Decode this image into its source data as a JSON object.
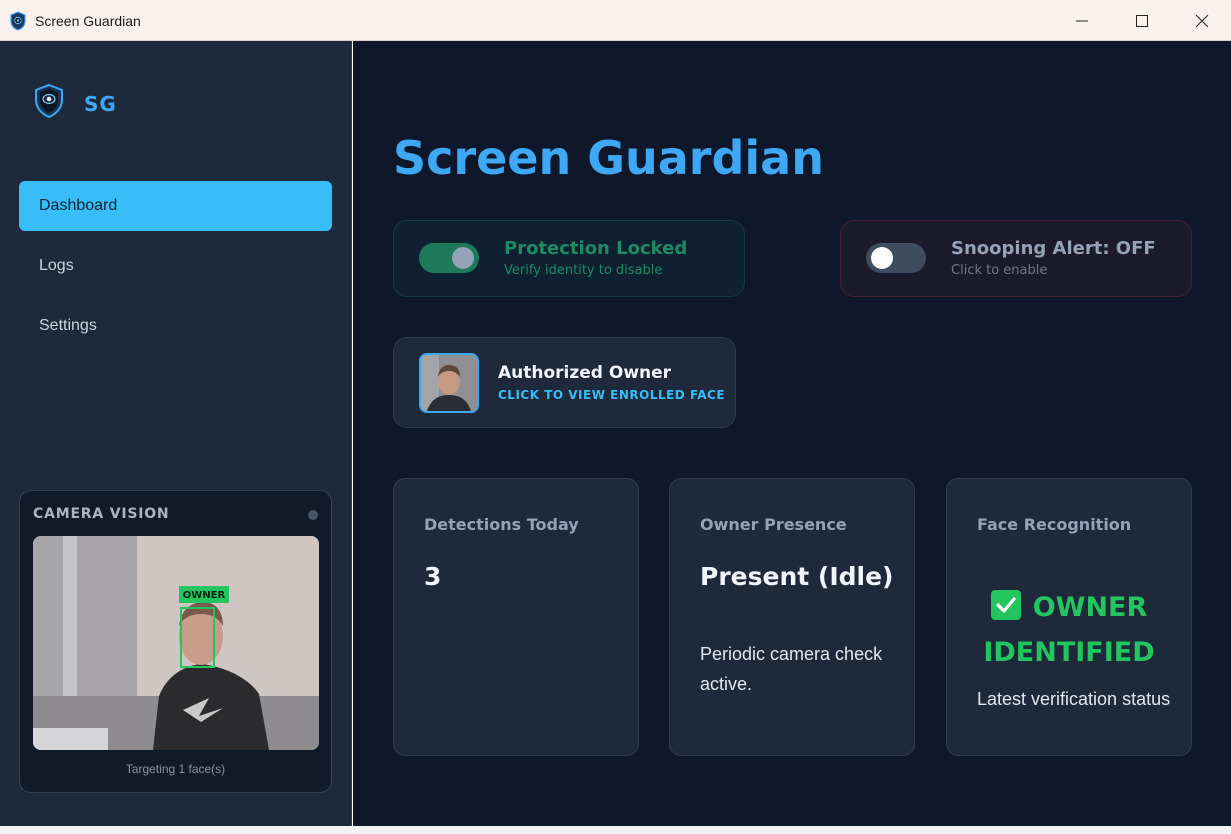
{
  "window": {
    "title": "Screen Guardian",
    "icons": [
      "shield-app-icon",
      "minimize-icon",
      "maximize-icon",
      "close-icon"
    ]
  },
  "sidebar": {
    "logo_text": "SG",
    "nav": [
      {
        "label": "Dashboard",
        "active": true
      },
      {
        "label": "Logs",
        "active": false
      },
      {
        "label": "Settings",
        "active": false
      }
    ],
    "camera": {
      "title": "CAMERA VISION",
      "overlay_label": "OWNER",
      "caption": "Targeting 1 face(s)"
    }
  },
  "main": {
    "title": "Screen Guardian",
    "protection": {
      "title": "Protection Locked",
      "subtitle": "Verify identity to disable",
      "state": "on"
    },
    "snooping": {
      "title": "Snooping Alert: OFF",
      "subtitle": "Click to enable",
      "state": "off"
    },
    "owner": {
      "title": "Authorized Owner",
      "subtitle": "CLICK TO VIEW ENROLLED FACE"
    },
    "stats": {
      "detections": {
        "label": "Detections Today",
        "value": "3"
      },
      "presence": {
        "label": "Owner Presence",
        "value": "Present (Idle)",
        "description": "Periodic camera check active."
      },
      "face": {
        "label": "Face Recognition",
        "status": "OWNER IDENTIFIED",
        "description": "Latest verification status"
      }
    }
  },
  "colors": {
    "accent": "#38bdf8",
    "title_blue": "#3ea8f5",
    "success": "#22c55e",
    "protect_green": "#1f8a63",
    "bg_main": "#0f172a",
    "bg_sidebar": "#1e293b"
  }
}
